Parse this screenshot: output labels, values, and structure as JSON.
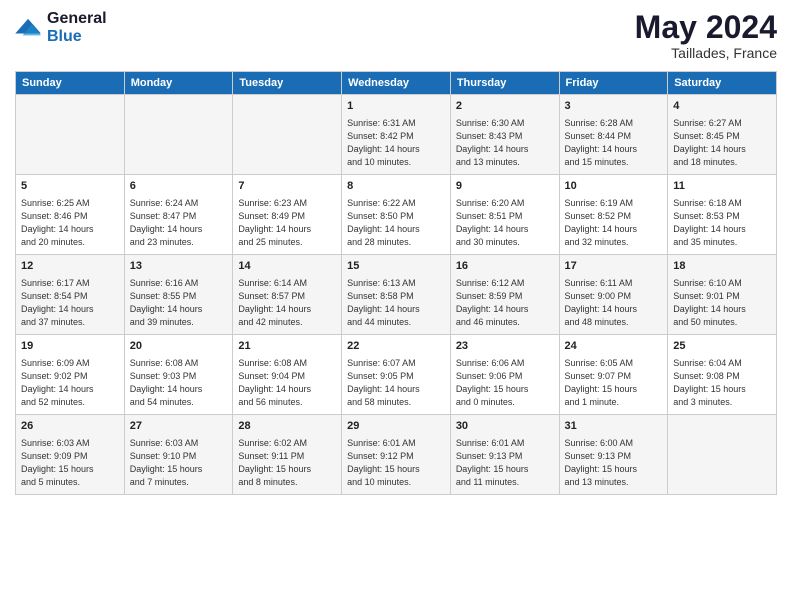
{
  "logo": {
    "line1": "General",
    "line2": "Blue"
  },
  "title": {
    "month_year": "May 2024",
    "location": "Taillades, France"
  },
  "headers": [
    "Sunday",
    "Monday",
    "Tuesday",
    "Wednesday",
    "Thursday",
    "Friday",
    "Saturday"
  ],
  "weeks": [
    [
      {
        "day": "",
        "info": ""
      },
      {
        "day": "",
        "info": ""
      },
      {
        "day": "",
        "info": ""
      },
      {
        "day": "1",
        "info": "Sunrise: 6:31 AM\nSunset: 8:42 PM\nDaylight: 14 hours\nand 10 minutes."
      },
      {
        "day": "2",
        "info": "Sunrise: 6:30 AM\nSunset: 8:43 PM\nDaylight: 14 hours\nand 13 minutes."
      },
      {
        "day": "3",
        "info": "Sunrise: 6:28 AM\nSunset: 8:44 PM\nDaylight: 14 hours\nand 15 minutes."
      },
      {
        "day": "4",
        "info": "Sunrise: 6:27 AM\nSunset: 8:45 PM\nDaylight: 14 hours\nand 18 minutes."
      }
    ],
    [
      {
        "day": "5",
        "info": "Sunrise: 6:25 AM\nSunset: 8:46 PM\nDaylight: 14 hours\nand 20 minutes."
      },
      {
        "day": "6",
        "info": "Sunrise: 6:24 AM\nSunset: 8:47 PM\nDaylight: 14 hours\nand 23 minutes."
      },
      {
        "day": "7",
        "info": "Sunrise: 6:23 AM\nSunset: 8:49 PM\nDaylight: 14 hours\nand 25 minutes."
      },
      {
        "day": "8",
        "info": "Sunrise: 6:22 AM\nSunset: 8:50 PM\nDaylight: 14 hours\nand 28 minutes."
      },
      {
        "day": "9",
        "info": "Sunrise: 6:20 AM\nSunset: 8:51 PM\nDaylight: 14 hours\nand 30 minutes."
      },
      {
        "day": "10",
        "info": "Sunrise: 6:19 AM\nSunset: 8:52 PM\nDaylight: 14 hours\nand 32 minutes."
      },
      {
        "day": "11",
        "info": "Sunrise: 6:18 AM\nSunset: 8:53 PM\nDaylight: 14 hours\nand 35 minutes."
      }
    ],
    [
      {
        "day": "12",
        "info": "Sunrise: 6:17 AM\nSunset: 8:54 PM\nDaylight: 14 hours\nand 37 minutes."
      },
      {
        "day": "13",
        "info": "Sunrise: 6:16 AM\nSunset: 8:55 PM\nDaylight: 14 hours\nand 39 minutes."
      },
      {
        "day": "14",
        "info": "Sunrise: 6:14 AM\nSunset: 8:57 PM\nDaylight: 14 hours\nand 42 minutes."
      },
      {
        "day": "15",
        "info": "Sunrise: 6:13 AM\nSunset: 8:58 PM\nDaylight: 14 hours\nand 44 minutes."
      },
      {
        "day": "16",
        "info": "Sunrise: 6:12 AM\nSunset: 8:59 PM\nDaylight: 14 hours\nand 46 minutes."
      },
      {
        "day": "17",
        "info": "Sunrise: 6:11 AM\nSunset: 9:00 PM\nDaylight: 14 hours\nand 48 minutes."
      },
      {
        "day": "18",
        "info": "Sunrise: 6:10 AM\nSunset: 9:01 PM\nDaylight: 14 hours\nand 50 minutes."
      }
    ],
    [
      {
        "day": "19",
        "info": "Sunrise: 6:09 AM\nSunset: 9:02 PM\nDaylight: 14 hours\nand 52 minutes."
      },
      {
        "day": "20",
        "info": "Sunrise: 6:08 AM\nSunset: 9:03 PM\nDaylight: 14 hours\nand 54 minutes."
      },
      {
        "day": "21",
        "info": "Sunrise: 6:08 AM\nSunset: 9:04 PM\nDaylight: 14 hours\nand 56 minutes."
      },
      {
        "day": "22",
        "info": "Sunrise: 6:07 AM\nSunset: 9:05 PM\nDaylight: 14 hours\nand 58 minutes."
      },
      {
        "day": "23",
        "info": "Sunrise: 6:06 AM\nSunset: 9:06 PM\nDaylight: 15 hours\nand 0 minutes."
      },
      {
        "day": "24",
        "info": "Sunrise: 6:05 AM\nSunset: 9:07 PM\nDaylight: 15 hours\nand 1 minute."
      },
      {
        "day": "25",
        "info": "Sunrise: 6:04 AM\nSunset: 9:08 PM\nDaylight: 15 hours\nand 3 minutes."
      }
    ],
    [
      {
        "day": "26",
        "info": "Sunrise: 6:03 AM\nSunset: 9:09 PM\nDaylight: 15 hours\nand 5 minutes."
      },
      {
        "day": "27",
        "info": "Sunrise: 6:03 AM\nSunset: 9:10 PM\nDaylight: 15 hours\nand 7 minutes."
      },
      {
        "day": "28",
        "info": "Sunrise: 6:02 AM\nSunset: 9:11 PM\nDaylight: 15 hours\nand 8 minutes."
      },
      {
        "day": "29",
        "info": "Sunrise: 6:01 AM\nSunset: 9:12 PM\nDaylight: 15 hours\nand 10 minutes."
      },
      {
        "day": "30",
        "info": "Sunrise: 6:01 AM\nSunset: 9:13 PM\nDaylight: 15 hours\nand 11 minutes."
      },
      {
        "day": "31",
        "info": "Sunrise: 6:00 AM\nSunset: 9:13 PM\nDaylight: 15 hours\nand 13 minutes."
      },
      {
        "day": "",
        "info": ""
      }
    ]
  ]
}
